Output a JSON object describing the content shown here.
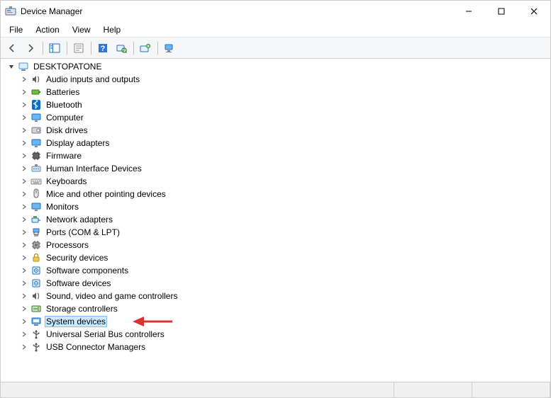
{
  "window": {
    "title": "Device Manager"
  },
  "menu": {
    "file": "File",
    "action": "Action",
    "view": "View",
    "help": "Help"
  },
  "toolbar": {
    "back": "Back",
    "forward": "Forward",
    "show_hide_tree": "Show/Hide Console Tree",
    "properties": "Properties",
    "help": "Help",
    "scan": "Scan for hardware changes",
    "add_legacy": "Add legacy hardware",
    "devices_printers": "Devices and Printers"
  },
  "tree": {
    "root": "DESKTOPATONE",
    "items": [
      {
        "id": "audio",
        "label": "Audio inputs and outputs",
        "icon": "speaker"
      },
      {
        "id": "batteries",
        "label": "Batteries",
        "icon": "battery"
      },
      {
        "id": "bluetooth",
        "label": "Bluetooth",
        "icon": "bluetooth"
      },
      {
        "id": "computer",
        "label": "Computer",
        "icon": "monitor"
      },
      {
        "id": "disk",
        "label": "Disk drives",
        "icon": "disk"
      },
      {
        "id": "display",
        "label": "Display adapters",
        "icon": "monitor"
      },
      {
        "id": "firmware",
        "label": "Firmware",
        "icon": "chip"
      },
      {
        "id": "hid",
        "label": "Human Interface Devices",
        "icon": "hid"
      },
      {
        "id": "keyboards",
        "label": "Keyboards",
        "icon": "keyboard"
      },
      {
        "id": "mice",
        "label": "Mice and other pointing devices",
        "icon": "mouse"
      },
      {
        "id": "monitors",
        "label": "Monitors",
        "icon": "monitor"
      },
      {
        "id": "network",
        "label": "Network adapters",
        "icon": "network"
      },
      {
        "id": "ports",
        "label": "Ports (COM & LPT)",
        "icon": "port"
      },
      {
        "id": "processors",
        "label": "Processors",
        "icon": "cpu"
      },
      {
        "id": "security",
        "label": "Security devices",
        "icon": "lock"
      },
      {
        "id": "swcomp",
        "label": "Software components",
        "icon": "component"
      },
      {
        "id": "swdev",
        "label": "Software devices",
        "icon": "component"
      },
      {
        "id": "sound",
        "label": "Sound, video and game controllers",
        "icon": "speaker"
      },
      {
        "id": "storage",
        "label": "Storage controllers",
        "icon": "storage"
      },
      {
        "id": "system",
        "label": "System devices",
        "icon": "system",
        "selected": true,
        "arrow": true
      },
      {
        "id": "usb",
        "label": "Universal Serial Bus controllers",
        "icon": "usb"
      },
      {
        "id": "usbconn",
        "label": "USB Connector Managers",
        "icon": "usb"
      }
    ]
  }
}
